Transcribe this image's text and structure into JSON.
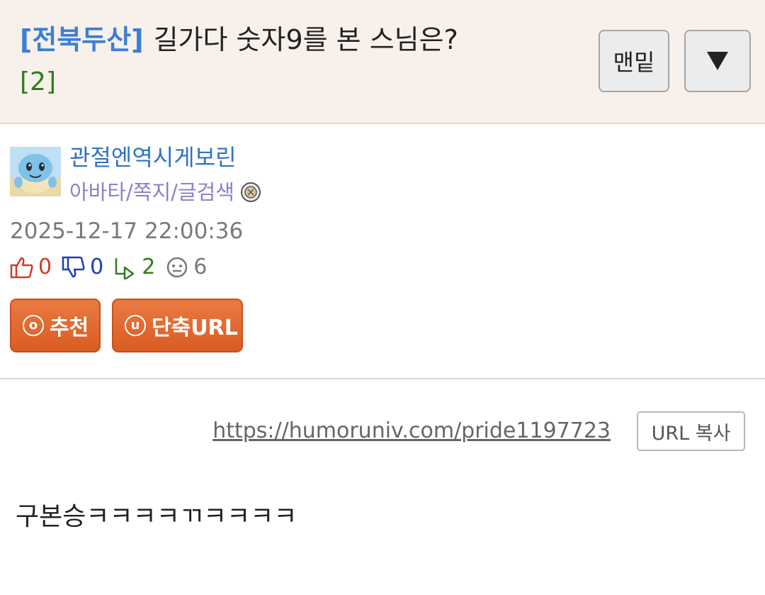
{
  "header": {
    "board_tag": "[전북두산]",
    "title": "길가다 숫자9를 본 스님은?",
    "reply_count": "[2]",
    "bottom_button": "맨밑",
    "more_icon": "triangle-down-icon"
  },
  "author": {
    "name": "관절엔역시게보린",
    "links": "아바타/쪽지/글검색",
    "avatar_icon": "squirtle-avatar",
    "badge_icon": "level-badge-icon"
  },
  "post": {
    "date": "2025-12-17 22:00:36",
    "url": "https://humoruniv.com/pride1197723",
    "copy_url_label": "URL 복사",
    "body": "구본승ㅋㅋㅋㅋㄲㅋㅋㅋㅋ"
  },
  "stats": {
    "up": "0",
    "down": "0",
    "replies": "2",
    "views": "6"
  },
  "actions": {
    "recommend_key": "o",
    "recommend_label": "추천",
    "shorturl_key": "u",
    "shorturl_label": "단축URL"
  },
  "colors": {
    "header_bg": "#f8f0ea",
    "board_tag": "#3a7fd6",
    "reply_count": "#2f7d1d",
    "author_name": "#2f73c2",
    "author_links": "#8b80c9",
    "action_button": "#e0672e",
    "up": "#d13a2b",
    "down": "#1a3fb0"
  }
}
